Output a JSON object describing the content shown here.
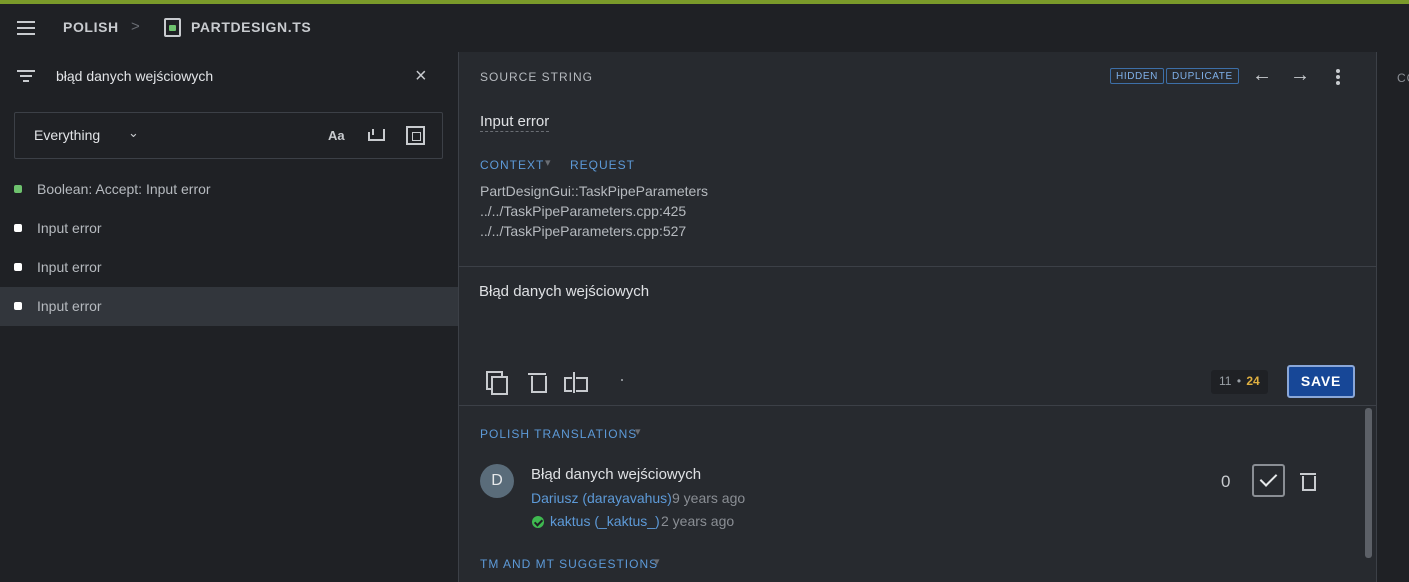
{
  "header": {
    "locale": "POLISH",
    "separator": ">",
    "file": "PARTDESIGN.TS",
    "accent_color": "#7a9a2a"
  },
  "search": {
    "value": "błąd danych wejściowych",
    "clear_icon": "×"
  },
  "filter": {
    "selected": "Everything",
    "chevron": "⌄",
    "case_label": "Aa"
  },
  "entities": [
    {
      "text": "Boolean: Accept: Input error",
      "status": "translated"
    },
    {
      "text": "Input error",
      "status": "missing"
    },
    {
      "text": "Input error",
      "status": "missing"
    },
    {
      "text": "Input error",
      "status": "missing",
      "active": true
    }
  ],
  "source": {
    "title": "SOURCE STRING",
    "badges": [
      "HIDDEN",
      "DUPLICATE"
    ],
    "prev": "←",
    "next": "→",
    "string": "Input error",
    "tabs": {
      "context": "CONTEXT",
      "request": "REQUEST",
      "caret": "▾"
    },
    "context_lines": [
      "PartDesignGui::TaskPipeParameters",
      "../../TaskPipeParameters.cpp:425",
      "../../TaskPipeParameters.cpp:527"
    ]
  },
  "editor": {
    "value": "Błąd danych wejściowych",
    "count": "11",
    "count_sep": "•",
    "max": "24",
    "save_label": "SAVE"
  },
  "history": {
    "title": "POLISH TRANSLATIONS",
    "caret": "▾",
    "avatar_letter": "D",
    "translation": "Błąd danych wejściowych",
    "user": "Dariusz (darayavahus)",
    "time": "9 years ago",
    "reviewer": "kaktus (_kaktus_)",
    "review_time": "2 years ago",
    "votes": "0"
  },
  "tm": {
    "title": "TM AND MT SUGGESTIONS",
    "caret": "▾"
  },
  "right": {
    "title": "COMMENTS"
  }
}
